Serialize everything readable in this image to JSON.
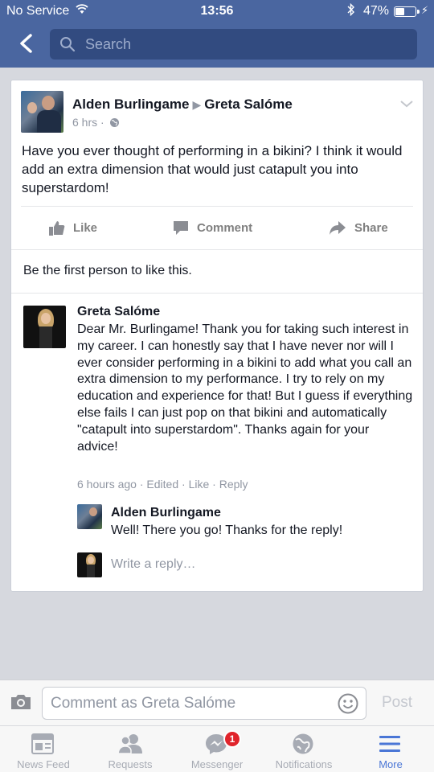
{
  "status_bar": {
    "carrier": "No Service",
    "time": "13:56",
    "battery_text": "47%",
    "battery_level": 0.47
  },
  "header": {
    "search_placeholder": "Search"
  },
  "post": {
    "author": "Alden Burlingame",
    "target": "Greta Salóme",
    "time": "6 hrs",
    "text": "Have you ever thought of performing in a bikini? I think it would add an extra dimension that would just catapult you into superstardom!",
    "actions": {
      "like": "Like",
      "comment": "Comment",
      "share": "Share"
    },
    "likes_text": "Be the first person to like this."
  },
  "comment": {
    "author": "Greta Salóme",
    "text": "Dear Mr. Burlingame! Thank you for taking such interest in my career. I can honestly say that I have never nor will I ever consider performing in a bikini to add what you call an extra dimension to my performance. I try to rely on my education and experience for that! But I guess if everything else fails I can just pop on that bikini and automatically \"catapult into superstardom\". Thanks again for your advice!",
    "time": "6 hours ago",
    "edited": "Edited",
    "like": "Like",
    "reply": "Reply",
    "separator": "·"
  },
  "reply": {
    "author": "Alden Burlingame",
    "text": "Well! There you go! Thanks for the reply!",
    "write_placeholder": "Write a reply…"
  },
  "comment_bar": {
    "placeholder": "Comment as Greta Salóme",
    "post_label": "Post"
  },
  "tabs": [
    {
      "label": "News Feed",
      "icon": "news-feed-icon"
    },
    {
      "label": "Requests",
      "icon": "friend-requests-icon"
    },
    {
      "label": "Messenger",
      "icon": "messenger-icon",
      "badge": "1"
    },
    {
      "label": "Notifications",
      "icon": "globe-icon"
    },
    {
      "label": "More",
      "icon": "menu-icon",
      "active": true
    }
  ],
  "colors": {
    "brand_blue": "#4a66a0",
    "active_tab": "#4a76d6",
    "badge_red": "#e0242b"
  }
}
